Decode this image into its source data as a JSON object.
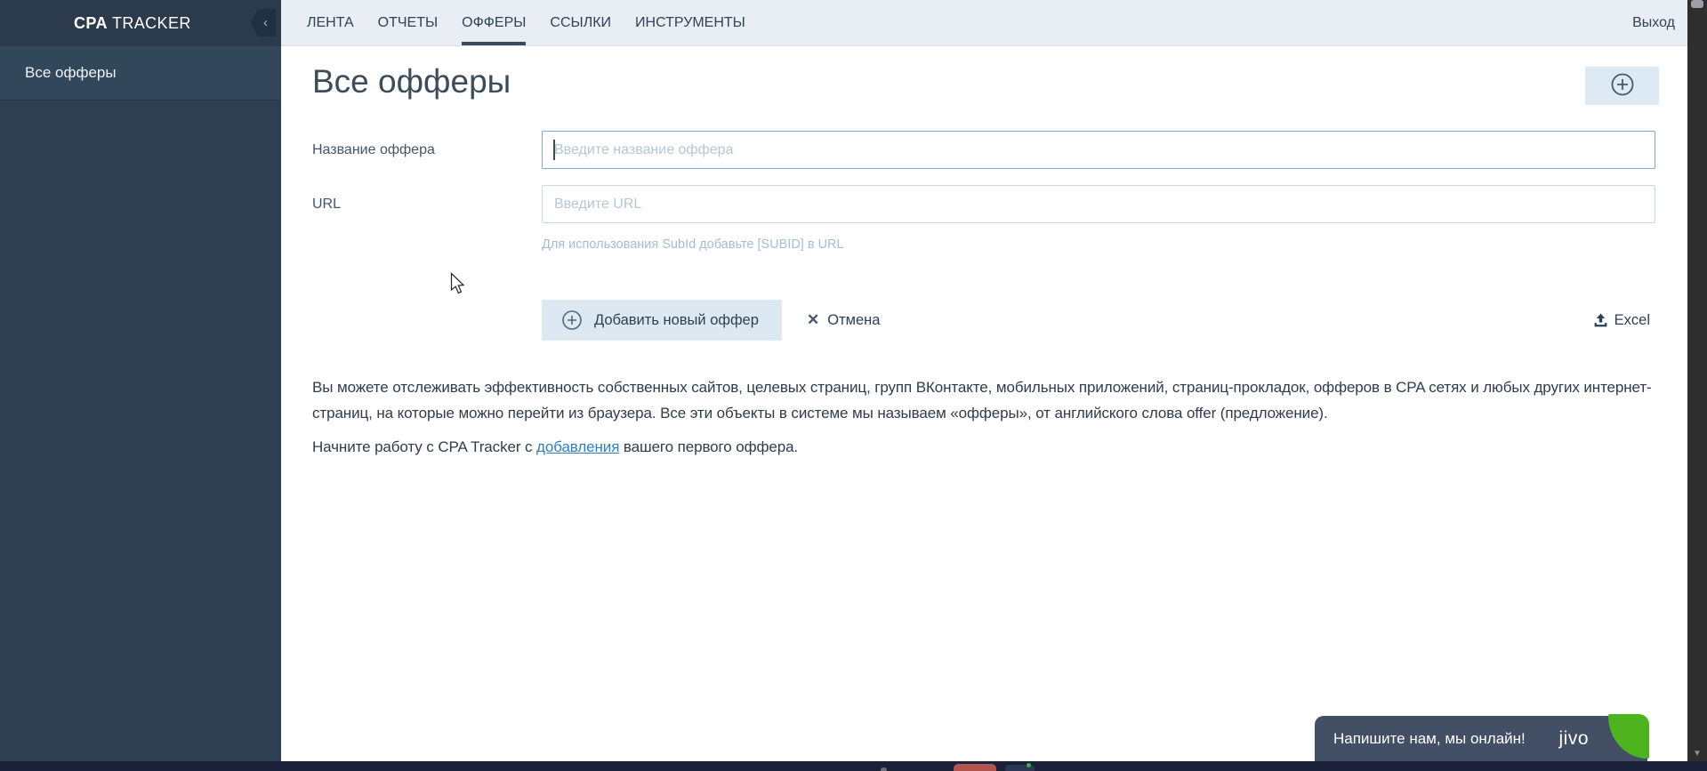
{
  "brand": {
    "bold": "CPA",
    "rest": " TRACKER"
  },
  "topnav": {
    "items": [
      {
        "label": "ЛЕНТА",
        "active": false
      },
      {
        "label": "ОТЧЕТЫ",
        "active": false
      },
      {
        "label": "ОФФЕРЫ",
        "active": true
      },
      {
        "label": "ССЫЛКИ",
        "active": false
      },
      {
        "label": "ИНСТРУМЕНТЫ",
        "active": false
      }
    ],
    "logout": "Выход"
  },
  "sidebar": {
    "items": [
      {
        "label": "Все офферы",
        "active": true
      }
    ]
  },
  "page": {
    "title": "Все офферы"
  },
  "form": {
    "fields": [
      {
        "label": "Название оффера",
        "placeholder": "Введите название оффера",
        "value": "",
        "focused": true
      },
      {
        "label": "URL",
        "placeholder": "Введите URL",
        "value": "",
        "hint": "Для использования SubId добавьте [SUBID] в URL"
      }
    ],
    "submit": "Добавить новый оффер",
    "cancel": "Отмена",
    "export": "Excel"
  },
  "intro": {
    "paragraph": "Вы можете отслеживать эффективность собственных сайтов, целевых страниц, групп ВКонтакте, мобильных приложений, страниц-прокладок, офферов в CPA сетях и любых других интернет-страниц, на которые можно перейти из браузера. Все эти объекты в системе мы называем «офферы», от английского слова offer (предложение).",
    "cta_before": "Начните работу с CPA Tracker с ",
    "cta_link": "добавления",
    "cta_after": " вашего первого оффера."
  },
  "chat": {
    "message": "Напишите нам, мы онлайн!",
    "brand": "jivo"
  },
  "icons": {
    "collapse": "‹",
    "close": "✕",
    "scroll_down": "▼"
  },
  "colors": {
    "accent_link": "#2d7fc1",
    "sidebar_bg": "#2d3f51",
    "sidebar_header_bg": "#2b3b4c",
    "sidebar_active_bg": "#33475a",
    "topbar_bg": "#e9eef4",
    "nav_text": "#2f4256",
    "button_bg": "#dce9f3",
    "focused_input_border": "#7fa8cb",
    "input_border": "#cbd8e2",
    "placeholder": "#b5c7d6",
    "hint_text": "#a3bed2",
    "chat_bg": "#434f64",
    "jivo_green": "#4db41f",
    "bottom_strip": "#1a2139"
  }
}
